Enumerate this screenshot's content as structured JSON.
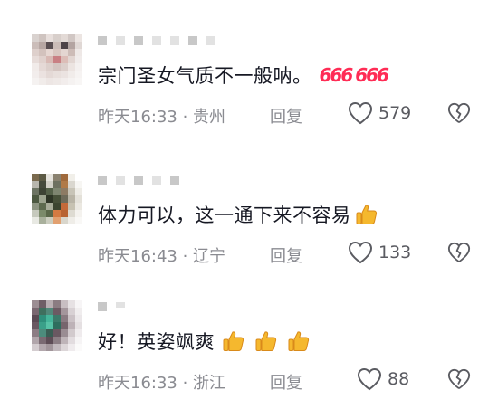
{
  "comments": [
    {
      "text": "宗门圣女气质不一般呐。",
      "emoji": "666 666",
      "time_location": "昨天16:33 · 贵州",
      "reply_label": "回复",
      "likes": "579"
    },
    {
      "text": "体力可以，这一通下来不容易",
      "emoji": "thumbs-up",
      "time_location": "昨天16:43 · 辽宁",
      "reply_label": "回复",
      "likes": "133"
    },
    {
      "text": "好！英姿飒爽",
      "emoji": "thumbs-up ×3",
      "time_location": "昨天16:33 · 浙江",
      "reply_label": "回复",
      "likes": "88"
    }
  ],
  "colors": {
    "text": "#161823",
    "meta": "#8a8b91",
    "emoji_666": "#ff2c55",
    "thumb": "#f5b82e"
  }
}
